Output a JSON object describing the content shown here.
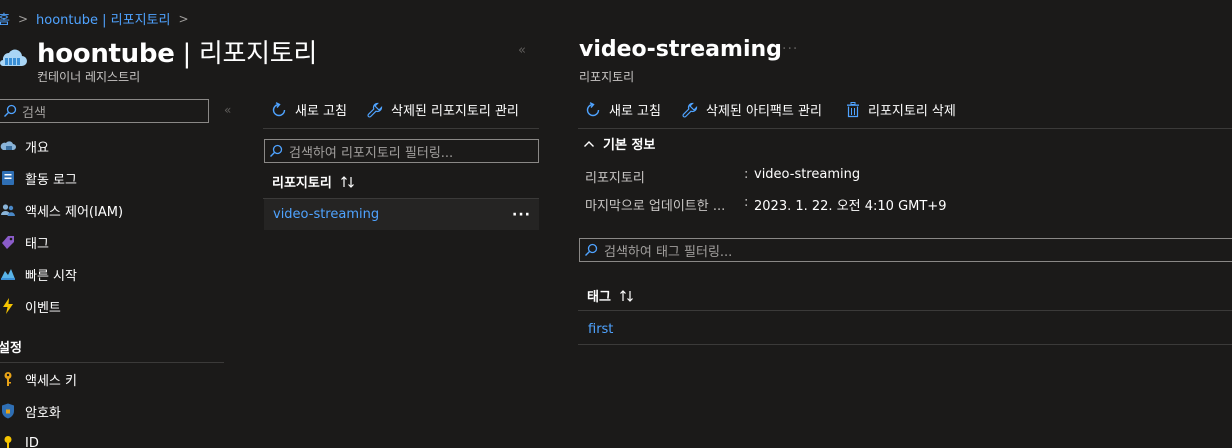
{
  "breadcrumb": {
    "home": "홈",
    "current": "hoontube | 리포지토리"
  },
  "resource": {
    "name": "hoontube",
    "separator": " | ",
    "section": "리포지토리",
    "type": "컨테이너 레지스트리"
  },
  "nav_search": {
    "placeholder": "검색"
  },
  "nav": {
    "items": [
      {
        "label": "개요",
        "icon": "cloud-overview-icon"
      },
      {
        "label": "활동 로그",
        "icon": "activity-log-icon"
      },
      {
        "label": "액세스 제어(IAM)",
        "icon": "people-iam-icon"
      },
      {
        "label": "태그",
        "icon": "tag-icon"
      },
      {
        "label": "빠른 시작",
        "icon": "quickstart-icon"
      },
      {
        "label": "이벤트",
        "icon": "lightning-icon"
      }
    ],
    "settings_header": "설정",
    "settings_items": [
      {
        "label": "액세스 키",
        "icon": "key-icon"
      },
      {
        "label": "암호화",
        "icon": "shield-icon"
      },
      {
        "label": "ID",
        "icon": "identity-key-icon"
      }
    ]
  },
  "repo_list": {
    "refresh_label": "새로 고침",
    "manage_deleted_label": "삭제된 리포지토리 관리",
    "filter_placeholder": "검색하여 리포지토리 필터링...",
    "column_header": "리포지토리",
    "rows": [
      {
        "name": "video-streaming"
      }
    ]
  },
  "detail": {
    "title": "video-streaming",
    "subtitle": "리포지토리",
    "more": "···",
    "refresh_label": "새로 고침",
    "manage_deleted_label": "삭제된 아티팩트 관리",
    "delete_label": "리포지토리 삭제",
    "essentials_label": "기본 정보",
    "properties": [
      {
        "label": "리포지토리",
        "value": "video-streaming"
      },
      {
        "label": "마지막으로 업데이트한 ...",
        "value": "2023. 1. 22. 오전 4:10 GMT+9"
      }
    ],
    "tag_filter_placeholder": "검색하여 태그 필터링...",
    "tag_column_header": "태그",
    "tags": [
      "first"
    ]
  },
  "colors": {
    "background": "#1b1a19",
    "link": "#4fa3ff",
    "border": "#8a8886"
  }
}
